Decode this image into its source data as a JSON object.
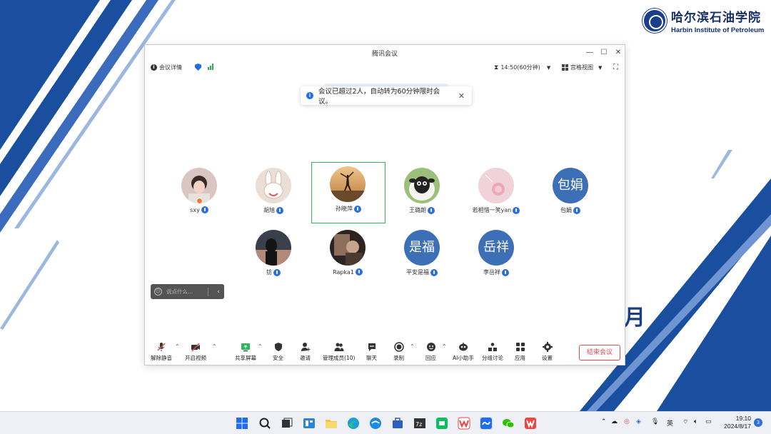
{
  "wallpaper": {
    "logo_cn": "哈尔滨石油学院",
    "logo_en": "Harbin Institute of Petroleum",
    "bg_letter": "月"
  },
  "window": {
    "title": "腾讯会议",
    "meeting_details": "会议详情",
    "timer": "14:50(60分钟)",
    "view_mode": "宫格视图"
  },
  "notice": {
    "text": "会议已超过2人，自动转为60分钟限时会议。"
  },
  "participants": [
    {
      "name": "sxy",
      "avatar_text": ""
    },
    {
      "name": "胡旭",
      "avatar_text": ""
    },
    {
      "name": "孙晓萍",
      "avatar_text": ""
    },
    {
      "name": "王璐朗",
      "avatar_text": ""
    },
    {
      "name": "若相惜一笑yan",
      "avatar_text": ""
    },
    {
      "name": "包娟",
      "avatar_text": "包娟"
    },
    {
      "name": "钫",
      "avatar_text": ""
    },
    {
      "name": "Rapka1",
      "avatar_text": ""
    },
    {
      "name": "平安是福",
      "avatar_text": "是福"
    },
    {
      "name": "李岳祥",
      "avatar_text": "岳祥"
    }
  ],
  "chat": {
    "placeholder": "说点什么..."
  },
  "toolbar": {
    "unmute": "解除静音",
    "start_video": "开启视频",
    "share_screen": "共享屏幕",
    "security": "安全",
    "invite": "邀请",
    "manage_members": "管理成员(10)",
    "chat": "聊天",
    "record": "录制",
    "reactions": "回应",
    "ai_assistant": "AI小助手",
    "breakout": "分组讨论",
    "apps": "应用",
    "settings": "设置",
    "end_meeting": "结束会议"
  },
  "taskbar": {
    "ime": "英",
    "time": "19:10",
    "date": "2024/8/17",
    "notifications": "3"
  },
  "colors": {
    "accent": "#2c6de0",
    "end": "#e24b4b",
    "active": "#2fb55a",
    "wallpaper_blue": "#1a4fa0"
  }
}
